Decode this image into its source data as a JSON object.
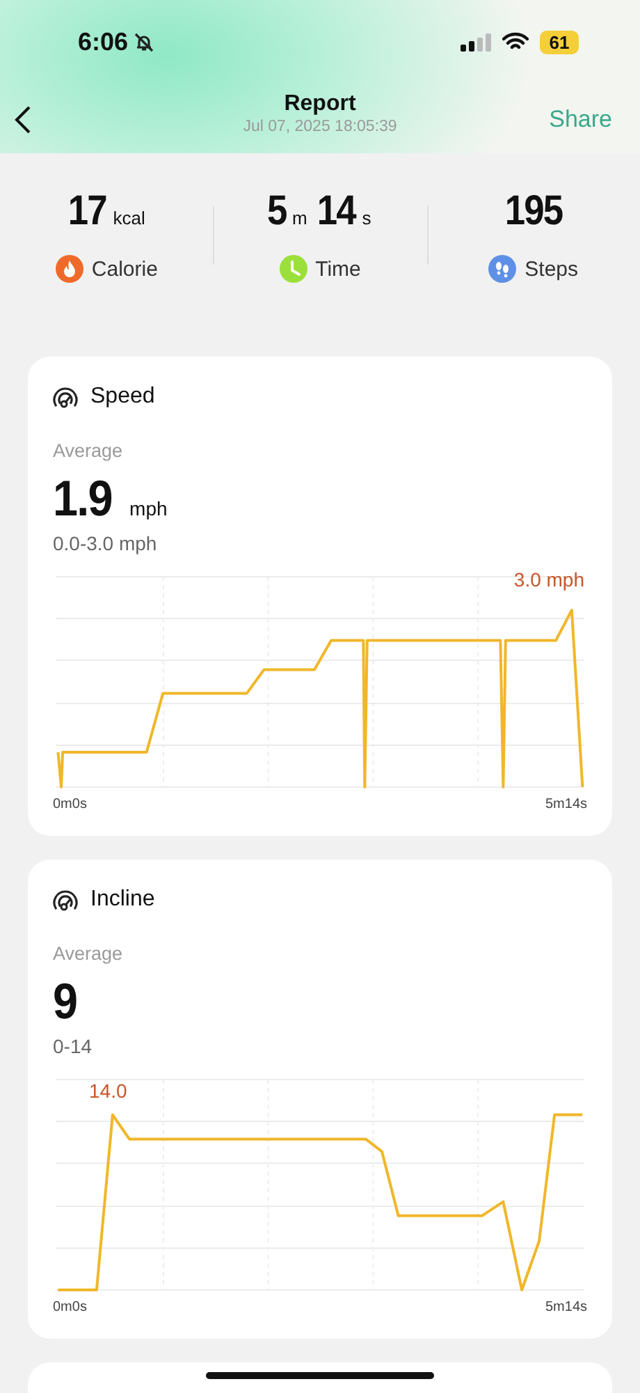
{
  "status_bar": {
    "time": "6:06",
    "battery": "61"
  },
  "header": {
    "title": "Report",
    "subtitle": "Jul 07, 2025 18:05:39",
    "action": "Share"
  },
  "stats": [
    {
      "kind": "calorie",
      "color": "#ef6a2a",
      "label": "Calorie",
      "value": [
        {
          "number": "17",
          "unit": "kcal"
        }
      ]
    },
    {
      "kind": "time",
      "color": "#9be03a",
      "label": "Time",
      "value": [
        {
          "number": "5",
          "unit": "m"
        },
        {
          "number": "14",
          "unit": "s"
        }
      ]
    },
    {
      "kind": "steps",
      "color": "#5f90e6",
      "label": "Steps",
      "value": [
        {
          "number": "195"
        }
      ]
    }
  ],
  "cards": [
    {
      "kind": "speed",
      "title": "Speed",
      "average_label": "Average",
      "value": "1.9",
      "unit": "mph",
      "range": "0.0-3.0 mph",
      "peak_label": "3.0 mph",
      "x_start": "0m0s",
      "x_end": "5m14s"
    },
    {
      "kind": "incline",
      "title": "Incline",
      "average_label": "Average",
      "value": "9",
      "range": "0-14",
      "peak_label": "14.0",
      "x_start": "0m0s",
      "x_end": "5m14s"
    }
  ]
}
